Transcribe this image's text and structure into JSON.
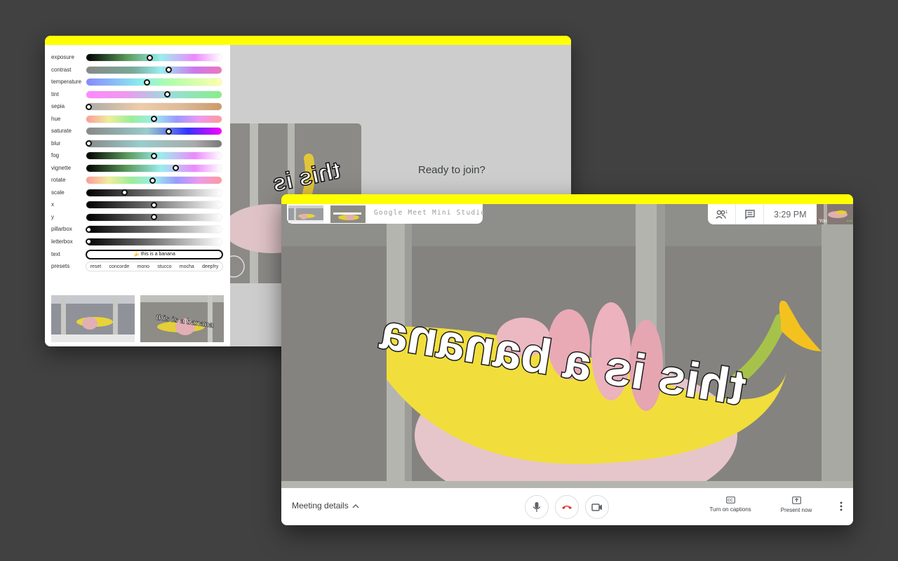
{
  "studio": {
    "sliders": [
      {
        "label": "exposure",
        "value": 0.47
      },
      {
        "label": "contrast",
        "value": 0.61
      },
      {
        "label": "temperature",
        "value": 0.45
      },
      {
        "label": "tint",
        "value": 0.6
      },
      {
        "label": "sepia",
        "value": 0.02
      },
      {
        "label": "hue",
        "value": 0.5
      },
      {
        "label": "saturate",
        "value": 0.61
      },
      {
        "label": "blur",
        "value": 0.02
      },
      {
        "label": "fog",
        "value": 0.5
      },
      {
        "label": "vignette",
        "value": 0.66
      },
      {
        "label": "rotate",
        "value": 0.49
      },
      {
        "label": "scale",
        "value": 0.28
      },
      {
        "label": "x",
        "value": 0.5
      },
      {
        "label": "y",
        "value": 0.5
      },
      {
        "label": "pillarbox",
        "value": 0.02
      },
      {
        "label": "letterbox",
        "value": 0.02
      }
    ],
    "text_label": "text",
    "text_value": "🍌 this is a banana",
    "presets_label": "presets",
    "presets": [
      "reset",
      "concorde",
      "mono",
      "stucco",
      "mocha",
      "deepfry"
    ],
    "thumb_caption": "this is a banana",
    "ready_text": "Ready to join?",
    "preview_caption": "this is"
  },
  "meet": {
    "chip_title": "Google Meet Mini Studio",
    "clock": "3:29 PM",
    "people_count": "1",
    "you_label": "You",
    "overlay_caption": "this is a banana",
    "meeting_details": "Meeting details",
    "captions_label": "Turn on captions",
    "present_label": "Present now"
  },
  "colors": {
    "accent_yellow": "#ffff00",
    "hangup_red": "#d93025",
    "icon_gray": "#5f6368"
  }
}
